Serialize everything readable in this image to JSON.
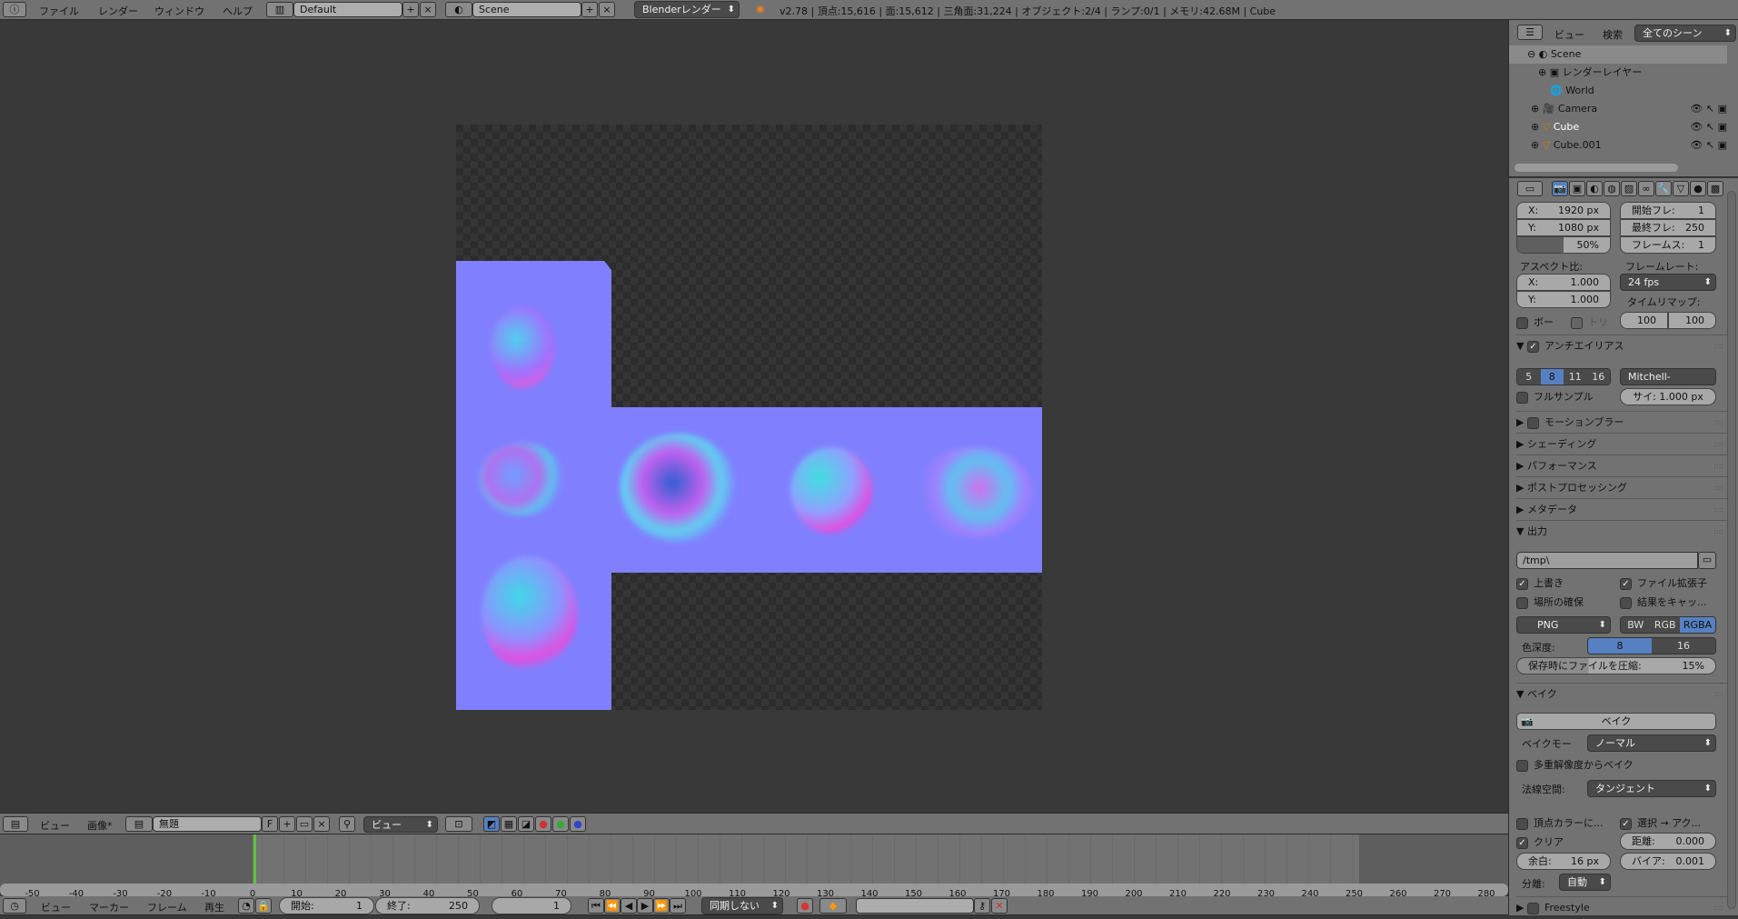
{
  "topbar": {
    "menus": [
      "ファイル",
      "レンダー",
      "ウィンドウ",
      "ヘルプ"
    ],
    "screen_layout": "Default",
    "scene": "Scene",
    "render_engine": "Blenderレンダー",
    "stats": "v2.78 | 頂点:15,616 | 面:15,612 | 三角面:31,224 | オブジェクト:2/4 | ランプ:0/1 | メモリ:42.68M | Cube"
  },
  "outliner": {
    "menu_view": "ビュー",
    "menu_search": "検索",
    "filter": "全てのシーン",
    "items": [
      "Scene",
      "レンダーレイヤー",
      "World",
      "Camera",
      "Cube",
      "Cube.001"
    ]
  },
  "render": {
    "res_x": "X:",
    "res_x_val": "1920 px",
    "res_y": "Y:",
    "res_y_val": "1080 px",
    "res_pct": "50%",
    "start_label": "開始フレ:",
    "start_val": "1",
    "end_label": "最終フレ:",
    "end_val": "250",
    "step_label": "フレームス:",
    "step_val": "1",
    "aspect_label": "アスペクト比:",
    "aspect_x": "1.000",
    "aspect_y": "1.000",
    "framerate_label": "フレームレート:",
    "framerate": "24 fps",
    "timeremap_label": "タイムリマップ:",
    "remap_old": "100",
    "remap_new": "100",
    "border": "ボー",
    "crop": "トリ",
    "aa_title": "アンチエイリアス",
    "aa_samples": [
      "5",
      "8",
      "11",
      "16"
    ],
    "aa_selected": "8",
    "aa_filter": "Mitchell-Netrav...",
    "full_sample": "フルサンプル",
    "filter_size": "サイ: 1.000 px",
    "sections": [
      "モーションブラー",
      "シェーディング",
      "パフォーマンス",
      "ポストプロセッシング",
      "メタデータ"
    ],
    "output_title": "出力",
    "output_path": "/tmp\\",
    "overwrite": "上書き",
    "file_ext": "ファイル拡張子",
    "placeholders": "場所の確保",
    "cache_result": "結果をキャッ...",
    "format": "PNG",
    "color_modes": [
      "BW",
      "RGB",
      "RGBA"
    ],
    "color_mode_selected": "RGBA",
    "depth_label": "色深度:",
    "depths": [
      "8",
      "16"
    ],
    "depth_selected": "8",
    "compress_label": "保存時にファイルを圧縮:",
    "compress_val": "15%",
    "bake_title": "ベイク",
    "bake_button": "ベイク",
    "bake_mode_label": "ベイクモー",
    "bake_mode": "ノーマル",
    "multires": "多重解像度からベイク",
    "normal_space_label": "法線空間:",
    "normal_space": "タンジェント",
    "vertex_color": "頂点カラーに...",
    "selected_to_active": "選択 → アク...",
    "clear": "クリア",
    "distance_label": "距離:",
    "distance_val": "0.000",
    "margin_label": "余白:",
    "margin_val": "16 px",
    "bias_label": "バイア:",
    "bias_val": "0.001",
    "split_label": "分離:",
    "split_val": "自動",
    "freestyle": "Freestyle"
  },
  "image_header": {
    "view": "ビュー",
    "image": "画像*",
    "image_name": "無題",
    "fake_user": "F",
    "display_mode": "ビュー"
  },
  "timeline": {
    "ticks": [
      -50,
      -40,
      -30,
      -20,
      -10,
      0,
      10,
      20,
      30,
      40,
      50,
      60,
      70,
      80,
      90,
      100,
      110,
      120,
      130,
      140,
      150,
      160,
      170,
      180,
      190,
      200,
      210,
      220,
      230,
      240,
      250,
      260,
      270,
      280
    ],
    "current_frame": 1,
    "start": 1,
    "end": 250
  },
  "timeline_header": {
    "menus": [
      "ビュー",
      "マーカー",
      "フレーム",
      "再生"
    ],
    "start_label": "開始:",
    "start_val": "1",
    "end_label": "終了:",
    "end_val": "250",
    "current": "1",
    "sync": "同期しない"
  },
  "colors": {
    "normal_map": "#8080fe",
    "selected": "#5680c2",
    "playhead": "#5ec43a"
  }
}
